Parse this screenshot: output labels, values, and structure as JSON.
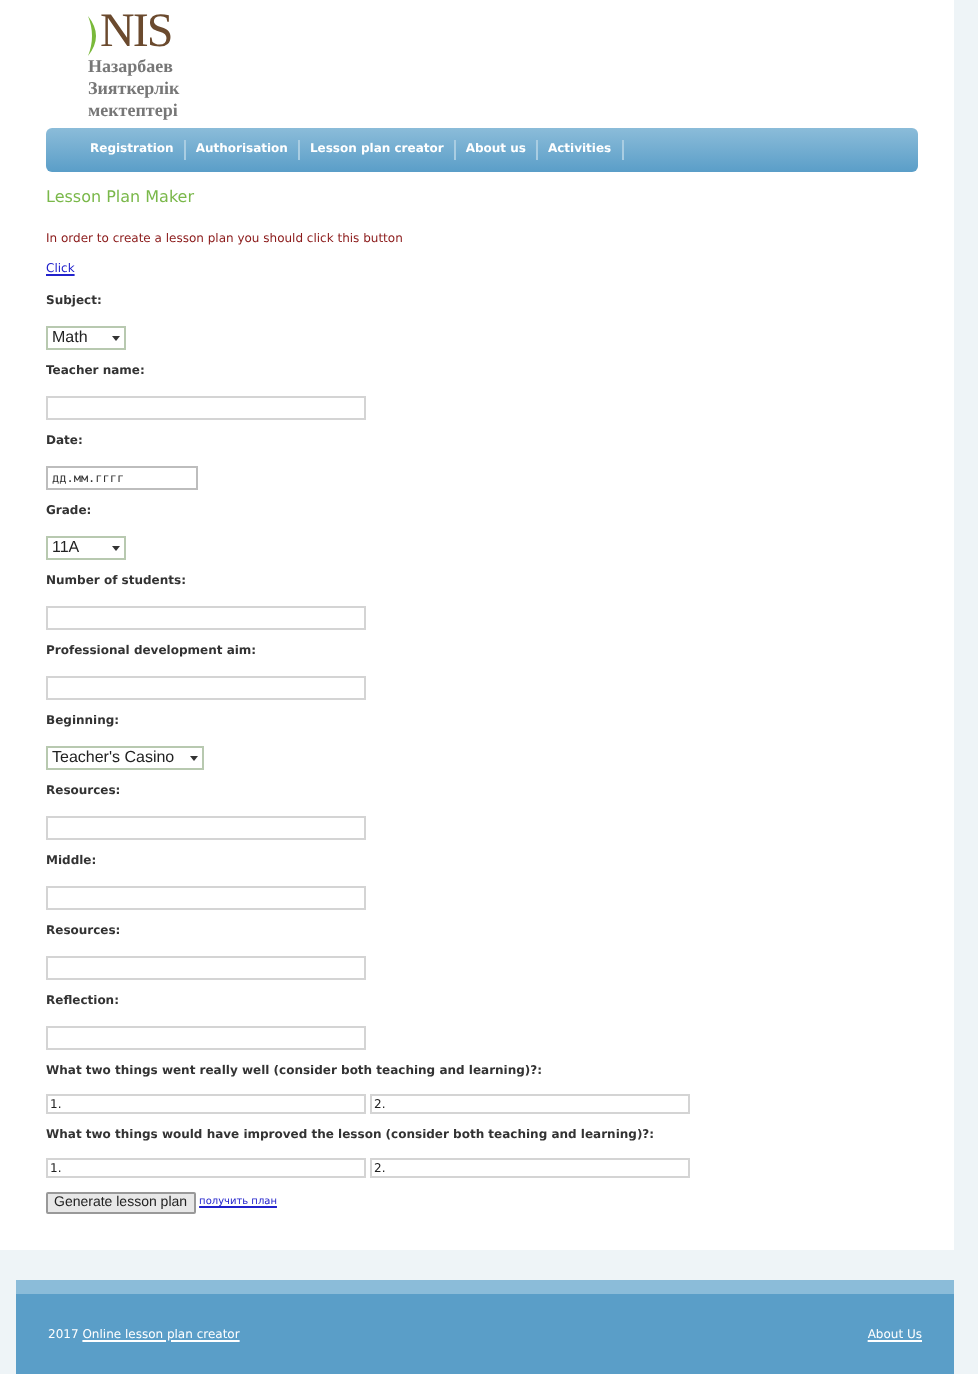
{
  "logo": {
    "mark": "NIS",
    "lines": [
      "Назарбаев",
      "Зияткерлік",
      "мектептері"
    ]
  },
  "nav": [
    "Registration",
    "Authorisation",
    "Lesson plan creator",
    "About us",
    "Activities"
  ],
  "title": "Lesson Plan Maker",
  "intro": "In order to create a lesson plan you should click this button",
  "click_link": "Click",
  "fields": [
    {
      "kind": "select",
      "label": "Subject:",
      "value": "Math"
    },
    {
      "kind": "text",
      "label": "Teacher name:"
    },
    {
      "kind": "date",
      "label": "Date:",
      "placeholder": "дд.мм.гггг"
    },
    {
      "kind": "select",
      "label": "Grade:",
      "value": "11A"
    },
    {
      "kind": "text",
      "label": "Number of students:"
    },
    {
      "kind": "text",
      "label": "Professional development aim:"
    },
    {
      "kind": "select",
      "label": "Beginning:",
      "value": "Teacher's Casino"
    },
    {
      "kind": "text",
      "label": "Resources:"
    },
    {
      "kind": "text",
      "label": "Middle:"
    },
    {
      "kind": "text",
      "label": "Resources:"
    },
    {
      "kind": "text",
      "label": "Reflection:"
    }
  ],
  "pairs": [
    {
      "label": "What two things went really well (consider both teaching and learning)?:",
      "values": [
        "1.",
        "2."
      ]
    },
    {
      "label": "What two things would have improved the lesson (consider both teaching and learning)?:",
      "values": [
        "1.",
        "2."
      ]
    }
  ],
  "generate_button": "Generate lesson plan",
  "get_plan_link": "получить план",
  "footer": {
    "year": "2017",
    "link": "Online lesson plan creator",
    "about": "About Us"
  }
}
